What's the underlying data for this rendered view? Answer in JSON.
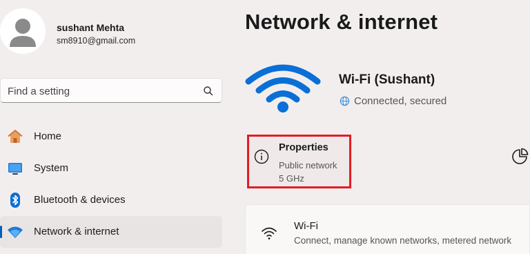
{
  "profile": {
    "name": "sushant Mehta",
    "email": "sm8910@gmail.com"
  },
  "search": {
    "placeholder": "Find a setting",
    "icon": "search-icon"
  },
  "nav": {
    "items": [
      {
        "label": "Home",
        "icon": "home-icon",
        "active": false
      },
      {
        "label": "System",
        "icon": "system-icon",
        "active": false
      },
      {
        "label": "Bluetooth & devices",
        "icon": "bluetooth-icon",
        "active": false
      },
      {
        "label": "Network & internet",
        "icon": "network-icon",
        "active": true
      }
    ]
  },
  "main": {
    "title": "Network & internet",
    "network": {
      "name": "Wi-Fi (Sushant)",
      "status": "Connected, secured"
    },
    "properties": {
      "title": "Properties",
      "network_type": "Public network",
      "band": "5 GHz"
    },
    "wifi_card": {
      "title": "Wi-Fi",
      "subtitle": "Connect, manage known networks, metered network"
    }
  },
  "colors": {
    "accent": "#005fb8",
    "wifi_blue": "#0a6fd6",
    "highlight_border": "#e31b23",
    "background": "#f3eeee"
  }
}
